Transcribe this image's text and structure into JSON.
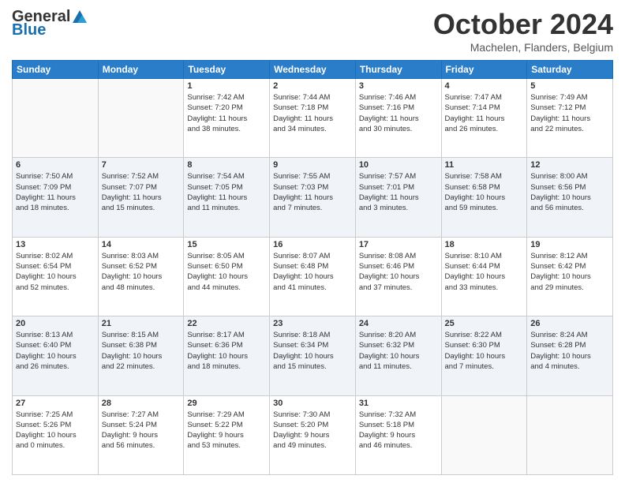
{
  "header": {
    "logo": {
      "general": "General",
      "blue": "Blue"
    },
    "title": "October 2024",
    "location": "Machelen, Flanders, Belgium"
  },
  "weekdays": [
    "Sunday",
    "Monday",
    "Tuesday",
    "Wednesday",
    "Thursday",
    "Friday",
    "Saturday"
  ],
  "weeks": [
    [
      {
        "day": "",
        "info": ""
      },
      {
        "day": "",
        "info": ""
      },
      {
        "day": "1",
        "info": "Sunrise: 7:42 AM\nSunset: 7:20 PM\nDaylight: 11 hours\nand 38 minutes."
      },
      {
        "day": "2",
        "info": "Sunrise: 7:44 AM\nSunset: 7:18 PM\nDaylight: 11 hours\nand 34 minutes."
      },
      {
        "day": "3",
        "info": "Sunrise: 7:46 AM\nSunset: 7:16 PM\nDaylight: 11 hours\nand 30 minutes."
      },
      {
        "day": "4",
        "info": "Sunrise: 7:47 AM\nSunset: 7:14 PM\nDaylight: 11 hours\nand 26 minutes."
      },
      {
        "day": "5",
        "info": "Sunrise: 7:49 AM\nSunset: 7:12 PM\nDaylight: 11 hours\nand 22 minutes."
      }
    ],
    [
      {
        "day": "6",
        "info": "Sunrise: 7:50 AM\nSunset: 7:09 PM\nDaylight: 11 hours\nand 18 minutes."
      },
      {
        "day": "7",
        "info": "Sunrise: 7:52 AM\nSunset: 7:07 PM\nDaylight: 11 hours\nand 15 minutes."
      },
      {
        "day": "8",
        "info": "Sunrise: 7:54 AM\nSunset: 7:05 PM\nDaylight: 11 hours\nand 11 minutes."
      },
      {
        "day": "9",
        "info": "Sunrise: 7:55 AM\nSunset: 7:03 PM\nDaylight: 11 hours\nand 7 minutes."
      },
      {
        "day": "10",
        "info": "Sunrise: 7:57 AM\nSunset: 7:01 PM\nDaylight: 11 hours\nand 3 minutes."
      },
      {
        "day": "11",
        "info": "Sunrise: 7:58 AM\nSunset: 6:58 PM\nDaylight: 10 hours\nand 59 minutes."
      },
      {
        "day": "12",
        "info": "Sunrise: 8:00 AM\nSunset: 6:56 PM\nDaylight: 10 hours\nand 56 minutes."
      }
    ],
    [
      {
        "day": "13",
        "info": "Sunrise: 8:02 AM\nSunset: 6:54 PM\nDaylight: 10 hours\nand 52 minutes."
      },
      {
        "day": "14",
        "info": "Sunrise: 8:03 AM\nSunset: 6:52 PM\nDaylight: 10 hours\nand 48 minutes."
      },
      {
        "day": "15",
        "info": "Sunrise: 8:05 AM\nSunset: 6:50 PM\nDaylight: 10 hours\nand 44 minutes."
      },
      {
        "day": "16",
        "info": "Sunrise: 8:07 AM\nSunset: 6:48 PM\nDaylight: 10 hours\nand 41 minutes."
      },
      {
        "day": "17",
        "info": "Sunrise: 8:08 AM\nSunset: 6:46 PM\nDaylight: 10 hours\nand 37 minutes."
      },
      {
        "day": "18",
        "info": "Sunrise: 8:10 AM\nSunset: 6:44 PM\nDaylight: 10 hours\nand 33 minutes."
      },
      {
        "day": "19",
        "info": "Sunrise: 8:12 AM\nSunset: 6:42 PM\nDaylight: 10 hours\nand 29 minutes."
      }
    ],
    [
      {
        "day": "20",
        "info": "Sunrise: 8:13 AM\nSunset: 6:40 PM\nDaylight: 10 hours\nand 26 minutes."
      },
      {
        "day": "21",
        "info": "Sunrise: 8:15 AM\nSunset: 6:38 PM\nDaylight: 10 hours\nand 22 minutes."
      },
      {
        "day": "22",
        "info": "Sunrise: 8:17 AM\nSunset: 6:36 PM\nDaylight: 10 hours\nand 18 minutes."
      },
      {
        "day": "23",
        "info": "Sunrise: 8:18 AM\nSunset: 6:34 PM\nDaylight: 10 hours\nand 15 minutes."
      },
      {
        "day": "24",
        "info": "Sunrise: 8:20 AM\nSunset: 6:32 PM\nDaylight: 10 hours\nand 11 minutes."
      },
      {
        "day": "25",
        "info": "Sunrise: 8:22 AM\nSunset: 6:30 PM\nDaylight: 10 hours\nand 7 minutes."
      },
      {
        "day": "26",
        "info": "Sunrise: 8:24 AM\nSunset: 6:28 PM\nDaylight: 10 hours\nand 4 minutes."
      }
    ],
    [
      {
        "day": "27",
        "info": "Sunrise: 7:25 AM\nSunset: 5:26 PM\nDaylight: 10 hours\nand 0 minutes."
      },
      {
        "day": "28",
        "info": "Sunrise: 7:27 AM\nSunset: 5:24 PM\nDaylight: 9 hours\nand 56 minutes."
      },
      {
        "day": "29",
        "info": "Sunrise: 7:29 AM\nSunset: 5:22 PM\nDaylight: 9 hours\nand 53 minutes."
      },
      {
        "day": "30",
        "info": "Sunrise: 7:30 AM\nSunset: 5:20 PM\nDaylight: 9 hours\nand 49 minutes."
      },
      {
        "day": "31",
        "info": "Sunrise: 7:32 AM\nSunset: 5:18 PM\nDaylight: 9 hours\nand 46 minutes."
      },
      {
        "day": "",
        "info": ""
      },
      {
        "day": "",
        "info": ""
      }
    ]
  ]
}
